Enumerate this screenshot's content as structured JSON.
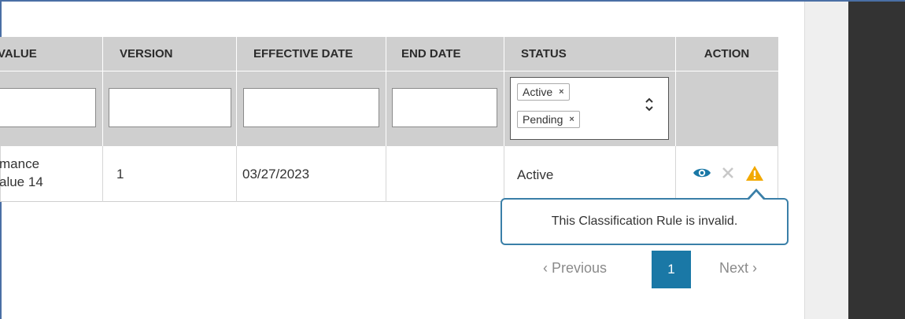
{
  "table": {
    "columns": [
      {
        "label": "VALUE"
      },
      {
        "label": "VERSION"
      },
      {
        "label": "EFFECTIVE DATE"
      },
      {
        "label": "END DATE"
      },
      {
        "label": "STATUS"
      },
      {
        "label": "ACTION"
      }
    ],
    "status_filter": {
      "selected": [
        {
          "label": "Active",
          "remove": "×"
        },
        {
          "label": "Pending",
          "remove": "×"
        }
      ]
    },
    "rows": [
      {
        "value_line1": "mance",
        "value_line2": "alue 14",
        "version": "1",
        "effective_date": "03/27/2023",
        "end_date": "",
        "status": "Active",
        "actions": [
          "eye-icon",
          "close-icon",
          "warning-icon"
        ]
      }
    ]
  },
  "tooltip": {
    "text": "This Classification Rule is invalid."
  },
  "pagination": {
    "previous": "‹ Previous",
    "current_page": "1",
    "next": "Next ›"
  },
  "colors": {
    "header_bg": "#cfcfcf",
    "accent": "#1a78a6",
    "warning": "#f2a900",
    "tooltip_border": "#3a7fa8"
  }
}
